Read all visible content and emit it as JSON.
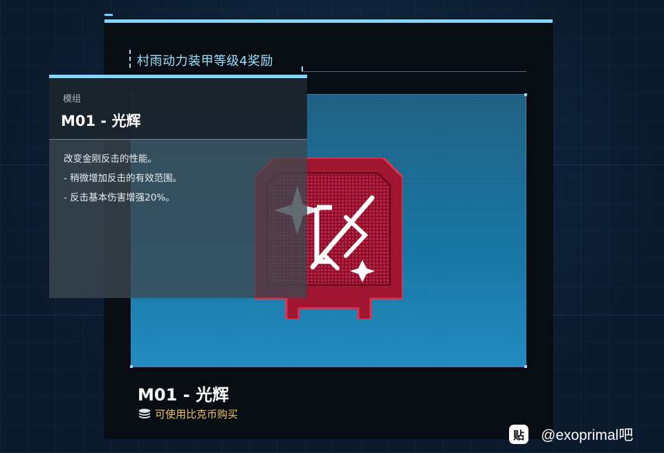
{
  "panel": {
    "title": "村雨动力装甲等级4奖励"
  },
  "reward": {
    "name": "M01 - 光辉",
    "purchase_note": "可使用比克币购买",
    "purchase_icon": "coins-stack-icon"
  },
  "tooltip": {
    "category": "模组",
    "name": "M01 - 光辉",
    "description": [
      "改变金刚反击的性能。",
      "- 稍微增加反击的有效范围。",
      "- 反击基本伤害增强20%。"
    ]
  },
  "watermark": {
    "icon_label": "贴",
    "text": "@exoprimal吧"
  },
  "colors": {
    "accent_cyan": "#7fd6ff",
    "title_text": "#9ee3ff",
    "emblem_red": "#b01838",
    "purchase_gold": "#f0c469"
  }
}
